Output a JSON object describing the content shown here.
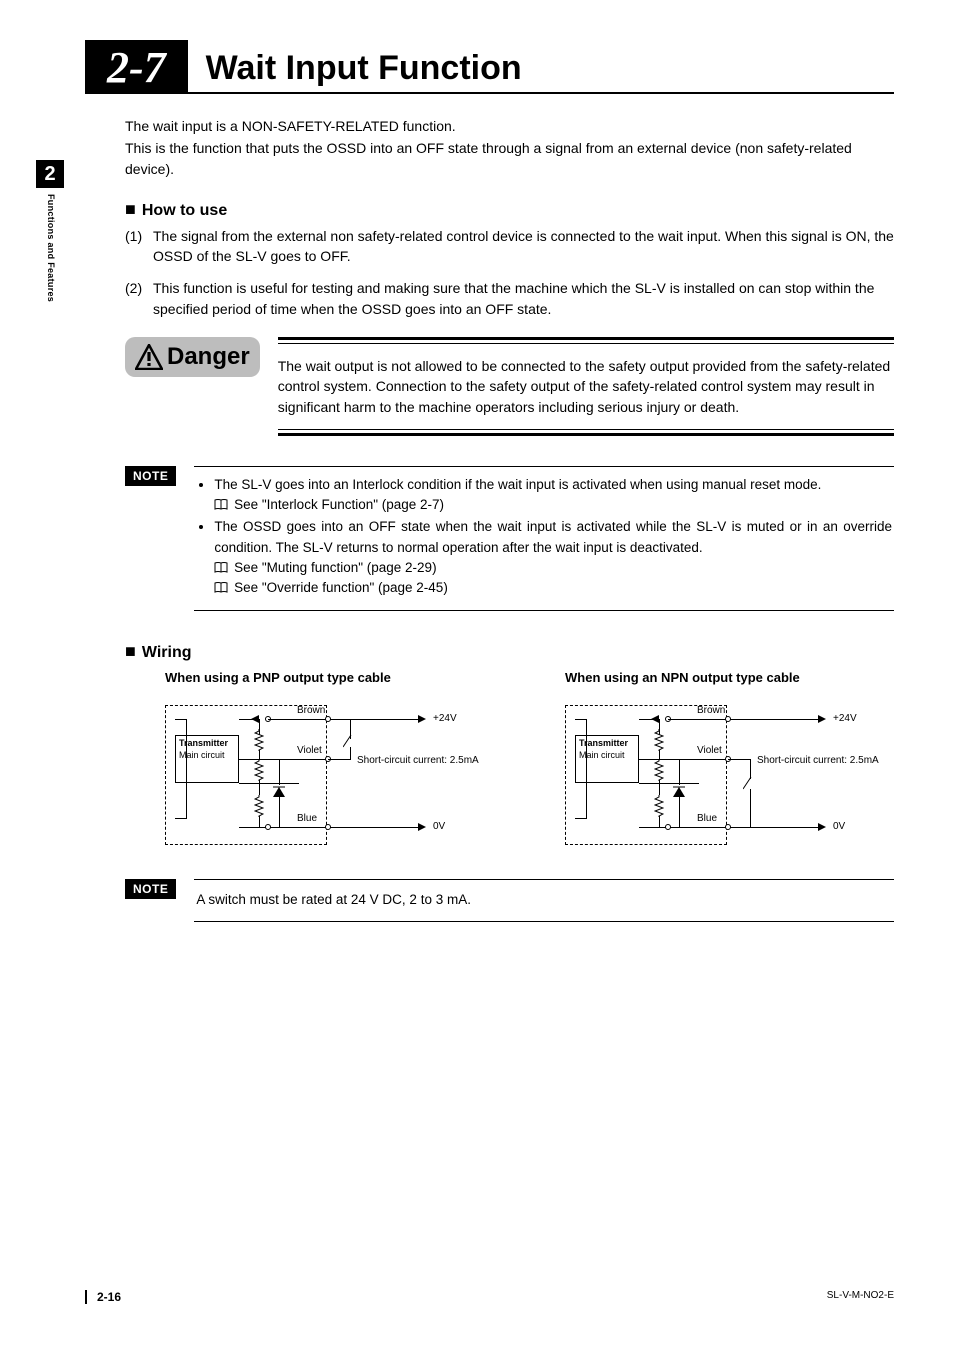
{
  "heading": {
    "number": "2-7",
    "title": "Wait Input Function"
  },
  "sidebar": {
    "chapter": "2",
    "label": "Functions and Features"
  },
  "intro": {
    "p1": "The wait input is a NON-SAFETY-RELATED function.",
    "p2": "This is the function that puts the OSSD into an OFF state through a signal from an external device (non safety-related device)."
  },
  "how": {
    "heading": "How to use",
    "item1_num": "(1)",
    "item1": "The signal from the external non safety-related control device is connected to the wait input. When this signal is ON, the OSSD of the SL-V goes to OFF.",
    "item2_num": "(2)",
    "item2": "This function is useful for testing and making sure that the machine which the SL-V is installed on can stop within the specified period of time when the OSSD goes into an OFF state."
  },
  "danger": {
    "label": "Danger",
    "text": "The wait output is not allowed to be connected to the safety output provided from the safety-related control system. Connection to the safety output of the safety-related control system may result in significant harm to the machine operators including serious injury or death."
  },
  "note1": {
    "label": "NOTE",
    "bullet1": "The SL-V goes into an Interlock condition if the wait input is activated when using manual reset mode.",
    "ref1": "See \"Interlock Function\" (page 2-7)",
    "bullet2": "The OSSD goes into an OFF state when the wait input is activated while the SL-V is muted or in an override condition.  The SL-V returns to normal operation after the wait input is deactivated.",
    "ref2": "See \"Muting function\" (page 2-29)",
    "ref3": "See \"Override function\" (page 2-45)"
  },
  "wiring": {
    "heading": "Wiring",
    "pnp_caption": "When using a PNP output type cable",
    "npn_caption": "When using an NPN output type cable",
    "labels": {
      "transmitter": "Transmitter",
      "main_circuit": "Main circuit",
      "brown": "Brown",
      "violet": "Violet",
      "blue": "Blue",
      "v24": "+24V",
      "v0": "0V",
      "short": "Short-circuit current: 2.5mA"
    }
  },
  "note2": {
    "label": "NOTE",
    "text": "A switch must be rated at 24 V DC, 2 to 3 mA."
  },
  "footer": {
    "page": "2-16",
    "doc": "SL-V-M-NO2-E"
  }
}
